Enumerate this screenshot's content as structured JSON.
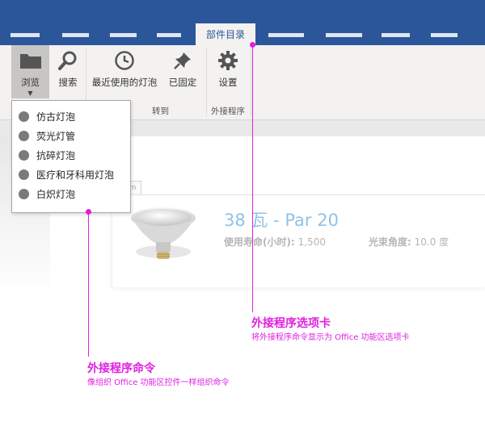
{
  "ribbon": {
    "active_tab": "部件目录",
    "buttons": {
      "browse": "浏览",
      "search": "搜索",
      "recent": "最近使用的灯泡",
      "pinned": "已固定",
      "settings": "设置"
    },
    "groups": {
      "goto": "转到",
      "addins": "外接程序"
    }
  },
  "dropdown": {
    "items": [
      "仿古灯泡",
      "荧光灯管",
      "抗碎灯泡",
      "医疗和牙科用灯泡",
      "白炽灯泡"
    ]
  },
  "product": {
    "title": "38 瓦 - Par 20",
    "life_label": "使用寿命(小时):",
    "life_value": "1,500",
    "angle_label": "光束角度:",
    "angle_value": "10.0 度",
    "tab_hint": "m"
  },
  "callouts": {
    "tab": {
      "title": "外接程序选项卡",
      "desc": "将外接程序命令显示为 Office 功能区选项卡"
    },
    "command": {
      "title": "外接程序命令",
      "desc": "像组织 Office 功能区控件一样组织命令"
    }
  },
  "colors": {
    "accent": "#2b579a",
    "callout": "#e020e0",
    "product_title": "#8fc2e6"
  },
  "icons": [
    "folder-icon",
    "search-icon",
    "clock-icon",
    "pin-icon",
    "gear-icon",
    "caret-down-icon",
    "bulb-image"
  ]
}
